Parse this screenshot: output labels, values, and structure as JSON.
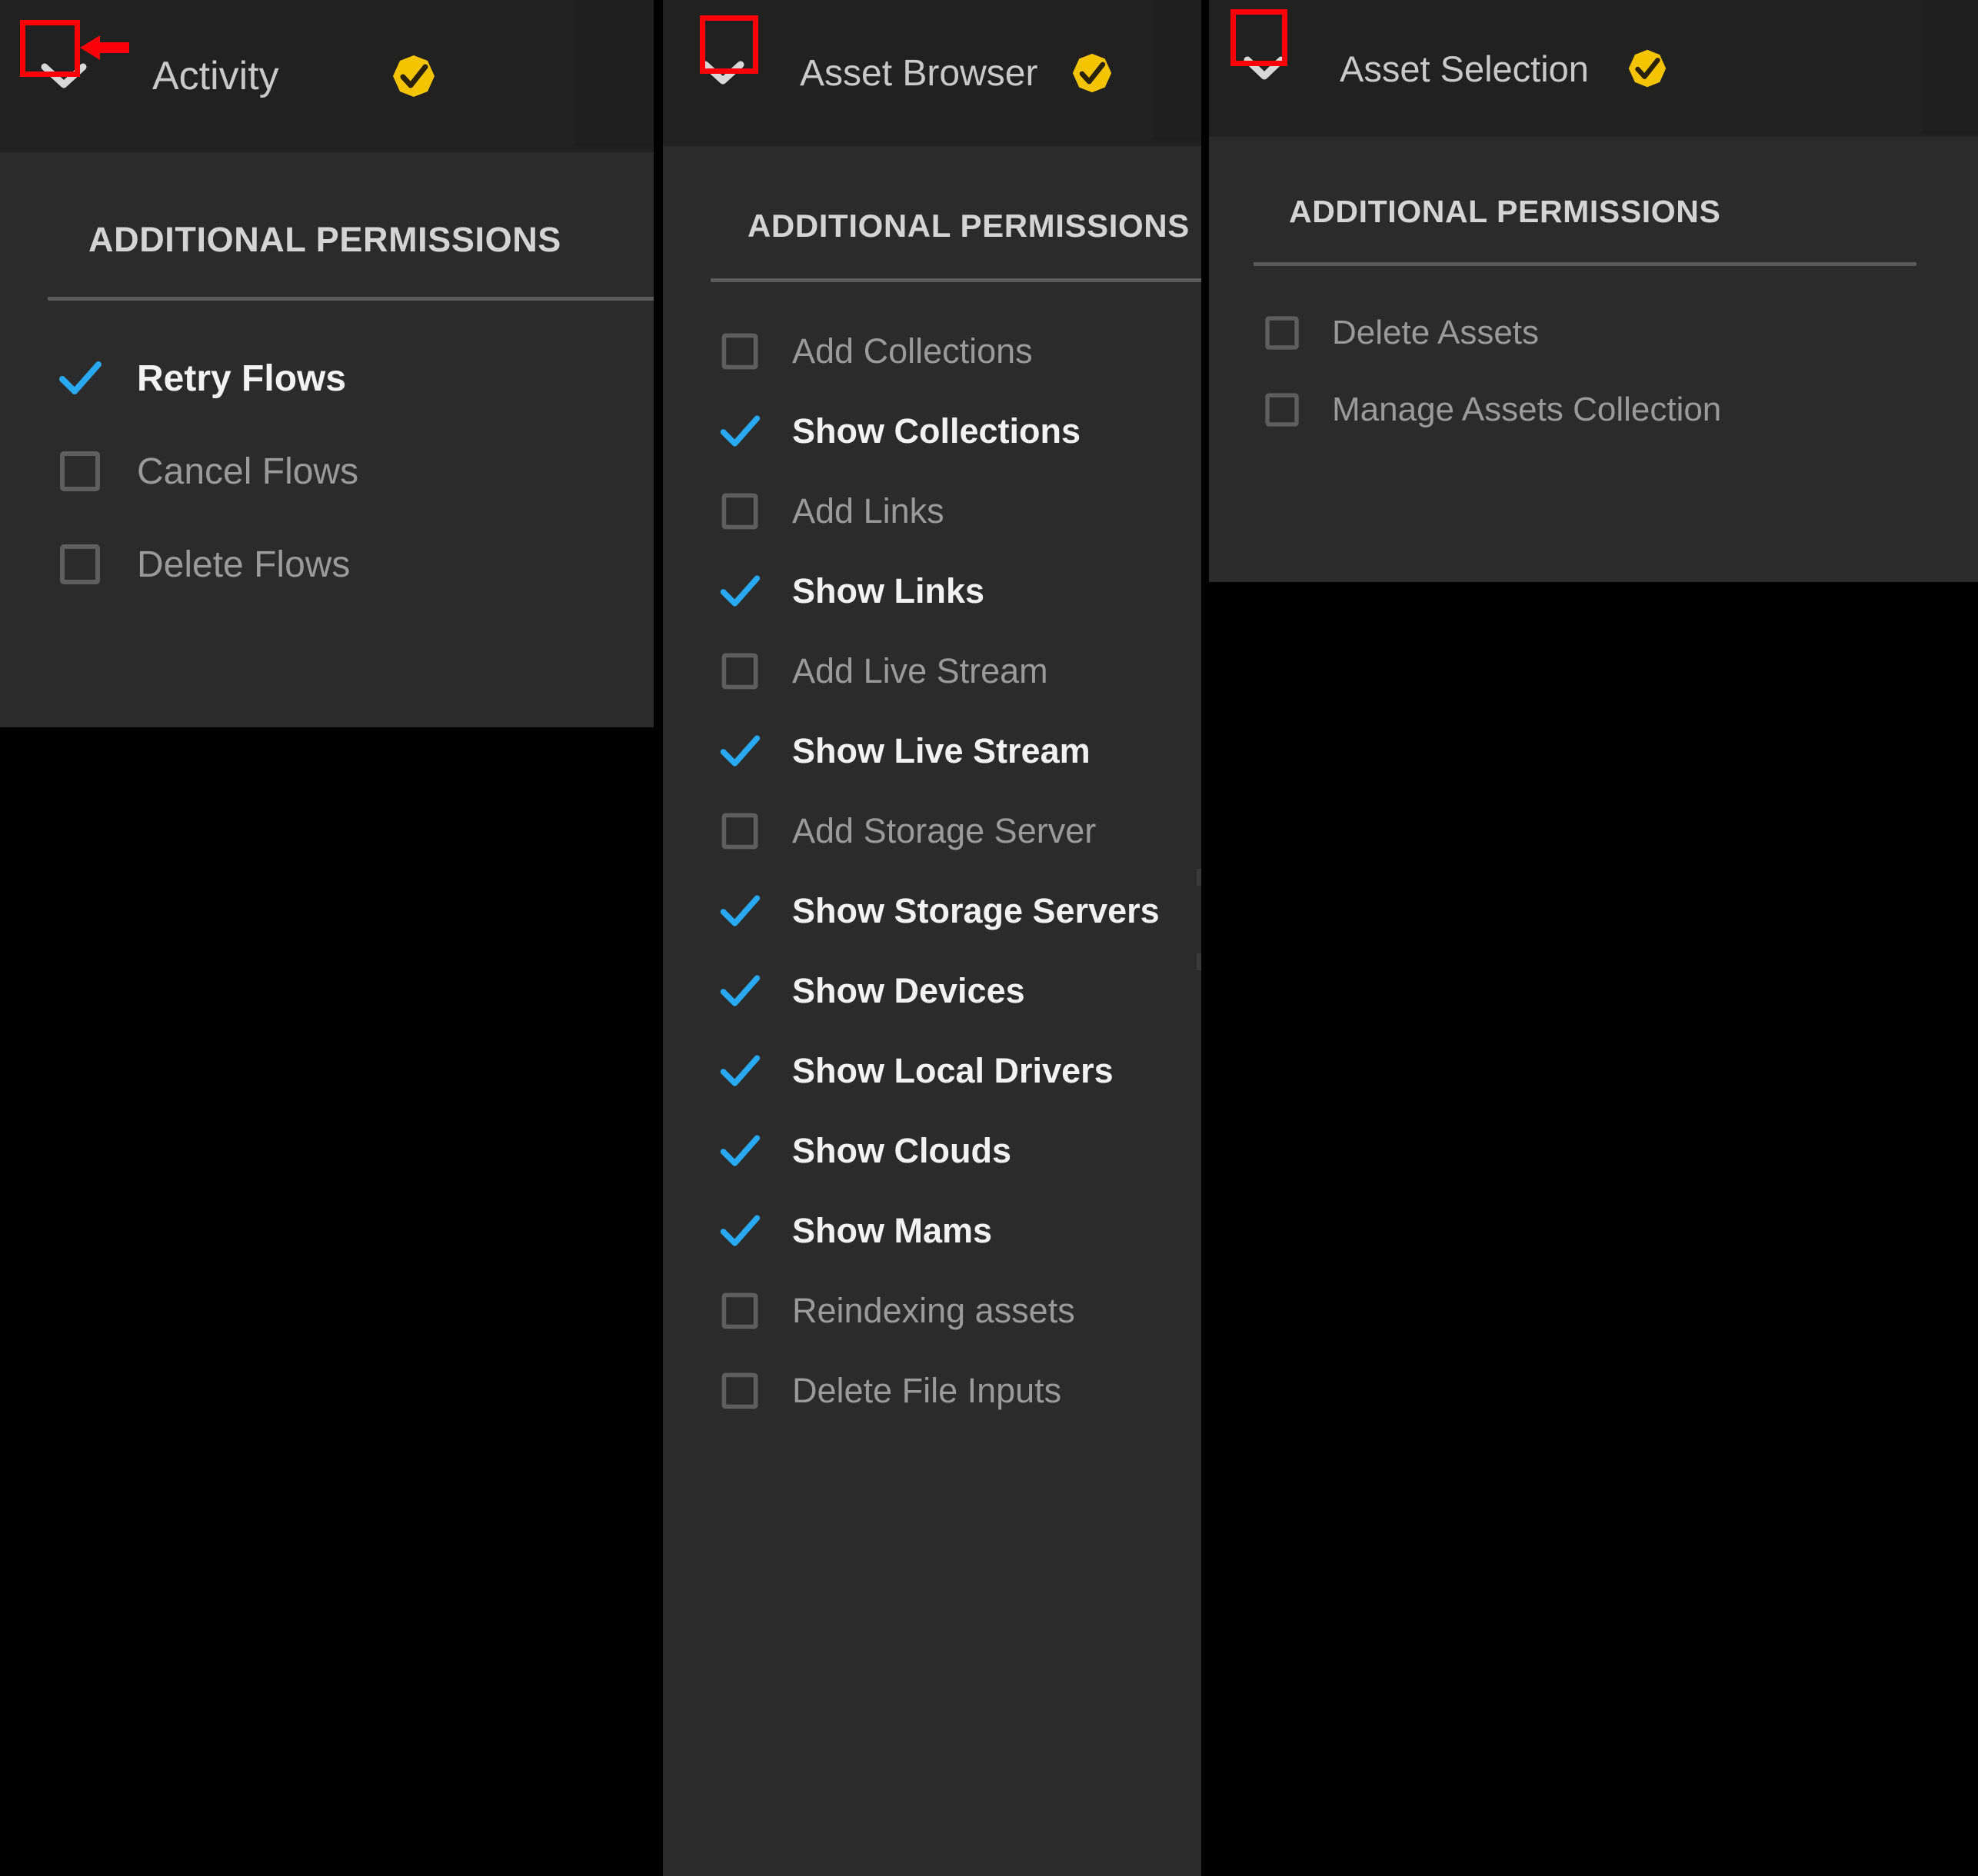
{
  "theme": {
    "page_background": "#000000",
    "panel_background": "#2b2b2b",
    "panel_header_background": "#212121",
    "checked_color": "#29a9f3",
    "unchecked_color": "#5e5e5e",
    "label_on_color": "#f2f2f2",
    "label_off_color": "#9a9a9a",
    "badge_color": "#f5c400",
    "annotation_color": "#fb0007"
  },
  "section_title": "ADDITIONAL PERMISSIONS",
  "icons": {
    "chevron": "chevron-down-icon",
    "badge": "yellow-check-badge-icon",
    "checked": "blue-check-icon",
    "unchecked": "empty-checkbox-icon",
    "annotation_rect": "red-highlight-rectangle",
    "annotation_arrow": "red-left-arrow"
  },
  "panels": [
    {
      "id": "activity",
      "title": "Activity",
      "expanded": true,
      "badge": true,
      "annotated": true,
      "has_arrow": true,
      "section_title": "ADDITIONAL PERMISSIONS",
      "permissions": [
        {
          "label": "Retry Flows",
          "checked": true
        },
        {
          "label": "Cancel Flows",
          "checked": false
        },
        {
          "label": "Delete Flows",
          "checked": false
        }
      ]
    },
    {
      "id": "asset-browser",
      "title": "Asset Browser",
      "expanded": true,
      "badge": true,
      "annotated": true,
      "has_arrow": false,
      "section_title": "ADDITIONAL PERMISSIONS",
      "permissions": [
        {
          "label": "Add Collections",
          "checked": false
        },
        {
          "label": "Show Collections",
          "checked": true
        },
        {
          "label": "Add Links",
          "checked": false
        },
        {
          "label": "Show Links",
          "checked": true
        },
        {
          "label": "Add Live Stream",
          "checked": false
        },
        {
          "label": "Show Live Stream",
          "checked": true
        },
        {
          "label": "Add Storage Server",
          "checked": false
        },
        {
          "label": "Show Storage Servers",
          "checked": true
        },
        {
          "label": "Show Devices",
          "checked": true
        },
        {
          "label": "Show Local Drivers",
          "checked": true
        },
        {
          "label": "Show Clouds",
          "checked": true
        },
        {
          "label": "Show Mams",
          "checked": true
        },
        {
          "label": "Reindexing assets",
          "checked": false
        },
        {
          "label": "Delete File Inputs",
          "checked": false
        }
      ]
    },
    {
      "id": "asset-selection",
      "title": "Asset Selection",
      "expanded": true,
      "badge": true,
      "annotated": true,
      "has_arrow": false,
      "section_title": "ADDITIONAL PERMISSIONS",
      "permissions": [
        {
          "label": "Delete Assets",
          "checked": false
        },
        {
          "label": "Manage Assets Collection",
          "checked": false
        }
      ]
    }
  ]
}
